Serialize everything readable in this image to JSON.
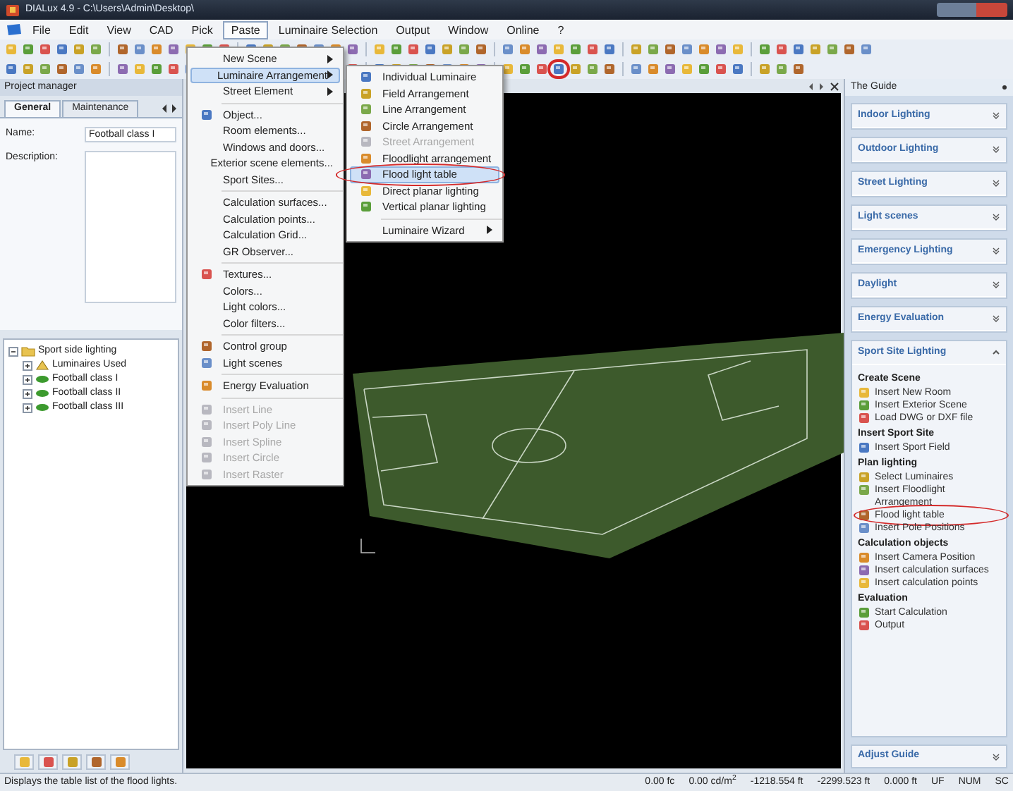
{
  "window": {
    "title": "DIALux 4.9 - C:\\Users\\Admin\\Desktop\\"
  },
  "menu_bar": [
    {
      "label": "File",
      "selected": false
    },
    {
      "label": "Edit",
      "selected": false
    },
    {
      "label": "View",
      "selected": false
    },
    {
      "label": "CAD",
      "selected": false
    },
    {
      "label": "Pick",
      "selected": false
    },
    {
      "label": "Paste",
      "selected": true
    },
    {
      "label": "Luminaire Selection",
      "selected": false
    },
    {
      "label": "Output",
      "selected": false
    },
    {
      "label": "Window",
      "selected": false
    },
    {
      "label": "Online",
      "selected": false
    },
    {
      "label": "?",
      "selected": false
    }
  ],
  "project_manager": {
    "title": "Project manager",
    "tabs": [
      {
        "label": "General",
        "selected": true
      },
      {
        "label": "Maintenance",
        "selected": false
      }
    ],
    "name_label": "Name:",
    "name_value": "Football class I",
    "description_label": "Description:"
  },
  "tree": {
    "label": "Sport side lighting",
    "expanded": true,
    "children": [
      {
        "label": "Luminaires Used",
        "expanded": false
      },
      {
        "label": "Football class I",
        "expanded": false
      },
      {
        "label": "Football class II",
        "expanded": false
      },
      {
        "label": "Football class III",
        "expanded": false
      }
    ]
  },
  "paste_menu": {
    "groups": [
      [
        {
          "label": "New Scene",
          "submenu": true,
          "disabled": false,
          "selected": false,
          "icon": false
        },
        {
          "label": "Luminaire Arrangement",
          "submenu": true,
          "disabled": false,
          "selected": true,
          "icon": false
        },
        {
          "label": "Street Element",
          "submenu": true,
          "disabled": false,
          "selected": false,
          "icon": false
        }
      ],
      [
        {
          "label": "Object...",
          "submenu": false,
          "disabled": false,
          "selected": false,
          "icon": true
        },
        {
          "label": "Room elements...",
          "submenu": false,
          "disabled": false,
          "selected": false,
          "icon": false
        },
        {
          "label": "Windows and doors...",
          "submenu": false,
          "disabled": false,
          "selected": false,
          "icon": false
        },
        {
          "label": "Exterior scene elements...",
          "submenu": false,
          "disabled": false,
          "selected": false,
          "icon": false
        },
        {
          "label": "Sport Sites...",
          "submenu": false,
          "disabled": false,
          "selected": false,
          "icon": false
        }
      ],
      [
        {
          "label": "Calculation surfaces...",
          "submenu": false,
          "disabled": false,
          "selected": false,
          "icon": false
        },
        {
          "label": "Calculation points...",
          "submenu": false,
          "disabled": false,
          "selected": false,
          "icon": false
        },
        {
          "label": "Calculation Grid...",
          "submenu": false,
          "disabled": false,
          "selected": false,
          "icon": false
        },
        {
          "label": "GR Observer...",
          "submenu": false,
          "disabled": false,
          "selected": false,
          "icon": false
        }
      ],
      [
        {
          "label": "Textures...",
          "submenu": false,
          "disabled": false,
          "selected": false,
          "icon": true
        },
        {
          "label": "Colors...",
          "submenu": false,
          "disabled": false,
          "selected": false,
          "icon": false
        },
        {
          "label": "Light colors...",
          "submenu": false,
          "disabled": false,
          "selected": false,
          "icon": false
        },
        {
          "label": "Color filters...",
          "submenu": false,
          "disabled": false,
          "selected": false,
          "icon": false
        }
      ],
      [
        {
          "label": "Control group",
          "submenu": false,
          "disabled": false,
          "selected": false,
          "icon": true
        },
        {
          "label": "Light scenes",
          "submenu": false,
          "disabled": false,
          "selected": false,
          "icon": true
        }
      ],
      [
        {
          "label": "Energy Evaluation",
          "submenu": false,
          "disabled": false,
          "selected": false,
          "icon": true
        }
      ],
      [
        {
          "label": "Insert Line",
          "submenu": false,
          "disabled": true,
          "selected": false,
          "icon": true
        },
        {
          "label": "Insert Poly Line",
          "submenu": false,
          "disabled": true,
          "selected": false,
          "icon": true
        },
        {
          "label": "Insert Spline",
          "submenu": false,
          "disabled": true,
          "selected": false,
          "icon": true
        },
        {
          "label": "Insert Circle",
          "submenu": false,
          "disabled": true,
          "selected": false,
          "icon": true
        },
        {
          "label": "Insert Raster",
          "submenu": false,
          "disabled": true,
          "selected": false,
          "icon": true
        }
      ]
    ]
  },
  "submenu": {
    "groups": [
      [
        {
          "label": "Individual Luminaire",
          "submenu": false,
          "disabled": false,
          "selected": false,
          "icon": true,
          "circled": false
        },
        {
          "label": "Field Arrangement",
          "submenu": false,
          "disabled": false,
          "selected": false,
          "icon": true,
          "circled": false
        },
        {
          "label": "Line Arrangement",
          "submenu": false,
          "disabled": false,
          "selected": false,
          "icon": true,
          "circled": false
        },
        {
          "label": "Circle Arrangement",
          "submenu": false,
          "disabled": false,
          "selected": false,
          "icon": true,
          "circled": false
        },
        {
          "label": "Street Arrangement",
          "submenu": false,
          "disabled": true,
          "selected": false,
          "icon": true,
          "circled": false
        },
        {
          "label": "Floodlight arrangement",
          "submenu": false,
          "disabled": false,
          "selected": false,
          "icon": true,
          "circled": false
        },
        {
          "label": "Flood light table",
          "submenu": false,
          "disabled": false,
          "selected": true,
          "icon": true,
          "circled": true
        },
        {
          "label": "Direct planar lighting",
          "submenu": false,
          "disabled": false,
          "selected": false,
          "icon": true,
          "circled": false
        },
        {
          "label": "Vertical planar lighting",
          "submenu": false,
          "disabled": false,
          "selected": false,
          "icon": true,
          "circled": false
        }
      ],
      [
        {
          "label": "Luminaire Wizard",
          "submenu": true,
          "disabled": false,
          "selected": false,
          "icon": false,
          "circled": false
        }
      ]
    ]
  },
  "guide": {
    "title": "The Guide",
    "sections": [
      {
        "label": "Indoor Lighting",
        "expanded": false
      },
      {
        "label": "Outdoor Lighting",
        "expanded": false
      },
      {
        "label": "Street Lighting",
        "expanded": false
      },
      {
        "label": "Light scenes",
        "expanded": false
      },
      {
        "label": "Emergency Lighting",
        "expanded": false
      },
      {
        "label": "Daylight",
        "expanded": false
      },
      {
        "label": "Energy Evaluation",
        "expanded": false
      },
      {
        "label": "Sport Site Lighting",
        "expanded": true,
        "groups": [
          {
            "heading": "Create Scene",
            "items": [
              {
                "label": "Insert New Room",
                "circled": false
              },
              {
                "label": "Insert Exterior Scene",
                "circled": false
              },
              {
                "label": "Load DWG or DXF file",
                "circled": false
              }
            ]
          },
          {
            "heading": "Insert Sport Site",
            "items": [
              {
                "label": "Insert Sport Field",
                "circled": false
              }
            ]
          },
          {
            "heading": "Plan lighting",
            "items": [
              {
                "label": "Select Luminaires",
                "circled": false
              },
              {
                "label": "Insert Floodlight Arrangement",
                "circled": false
              },
              {
                "label": "Flood light table",
                "circled": true
              },
              {
                "label": "Insert Pole Positions",
                "circled": false
              }
            ]
          },
          {
            "heading": "Calculation objects",
            "items": [
              {
                "label": "Insert Camera Position",
                "circled": false
              },
              {
                "label": "Insert calculation surfaces",
                "circled": false
              },
              {
                "label": "Insert calculation points",
                "circled": false
              }
            ]
          },
          {
            "heading": "Evaluation",
            "items": [
              {
                "label": "Start Calculation",
                "circled": false
              },
              {
                "label": "Output",
                "circled": false
              }
            ]
          }
        ]
      }
    ],
    "footer": "Adjust Guide"
  },
  "status_bar": {
    "message": "Displays the table list of the flood lights.",
    "cells": [
      "0.00 fc",
      "0.00 cd/m$^{2}$",
      "-1218.554 ft",
      "-2299.523 ft",
      "0.000 ft",
      "UF",
      "NUM",
      "SC"
    ]
  }
}
